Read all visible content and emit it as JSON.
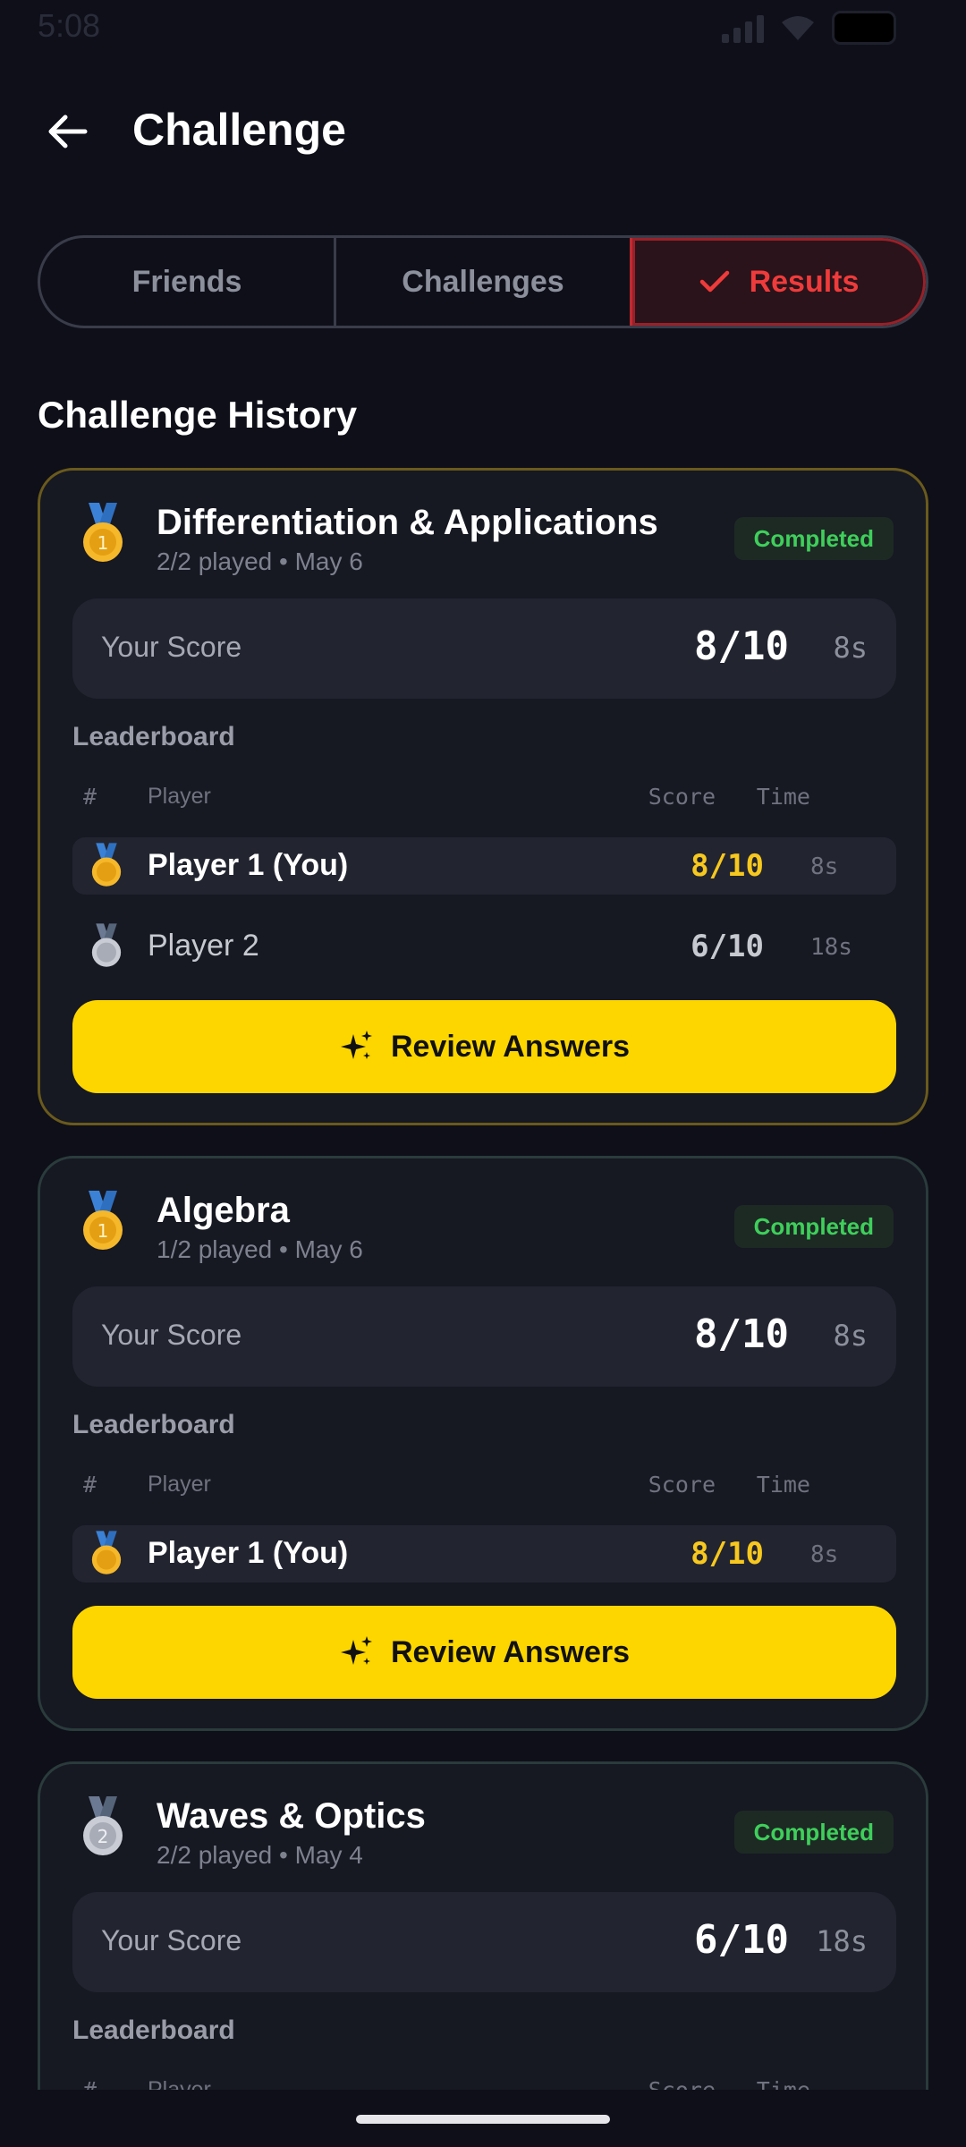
{
  "status_bar": {
    "time": "5:08"
  },
  "header": {
    "title": "Challenge"
  },
  "tabs": [
    {
      "label": "Friends",
      "active": false
    },
    {
      "label": "Challenges",
      "active": false
    },
    {
      "label": "Results",
      "active": true
    }
  ],
  "section_title": "Challenge History",
  "cards": [
    {
      "title": "Differentiation & Applications",
      "subtitle": "2/2 played • May 6",
      "medal": "gold",
      "badge": "Completed",
      "score_label": "Your Score",
      "score": "8/10",
      "time": "8s",
      "leaderboard_title": "Leaderboard",
      "headers": {
        "rank": "#",
        "player": "Player",
        "score": "Score",
        "time": "Time"
      },
      "rows": [
        {
          "medal": "gold",
          "name": "Player 1 (You)",
          "score": "8/10",
          "time": "8s",
          "you": true
        },
        {
          "medal": "silver",
          "name": "Player 2",
          "score": "6/10",
          "time": "18s",
          "you": false
        }
      ],
      "button": "Review Answers"
    },
    {
      "title": "Algebra",
      "subtitle": "1/2 played • May 6",
      "medal": "gold",
      "badge": "Completed",
      "score_label": "Your Score",
      "score": "8/10",
      "time": "8s",
      "leaderboard_title": "Leaderboard",
      "headers": {
        "rank": "#",
        "player": "Player",
        "score": "Score",
        "time": "Time"
      },
      "rows": [
        {
          "medal": "gold",
          "name": "Player 1 (You)",
          "score": "8/10",
          "time": "8s",
          "you": true
        }
      ],
      "button": "Review Answers"
    },
    {
      "title": "Waves & Optics",
      "subtitle": "2/2 played • May 4",
      "medal": "silver",
      "badge": "Completed",
      "score_label": "Your Score",
      "score": "6/10",
      "time": "18s",
      "leaderboard_title": "Leaderboard",
      "headers": {
        "rank": "#",
        "player": "Player",
        "score": "Score",
        "time": "Time"
      }
    }
  ],
  "colors": {
    "background": "#0e0f18",
    "accent_red": "#ef3b3b",
    "accent_yellow": "#fdd600",
    "completed_green": "#3fcf5b"
  }
}
